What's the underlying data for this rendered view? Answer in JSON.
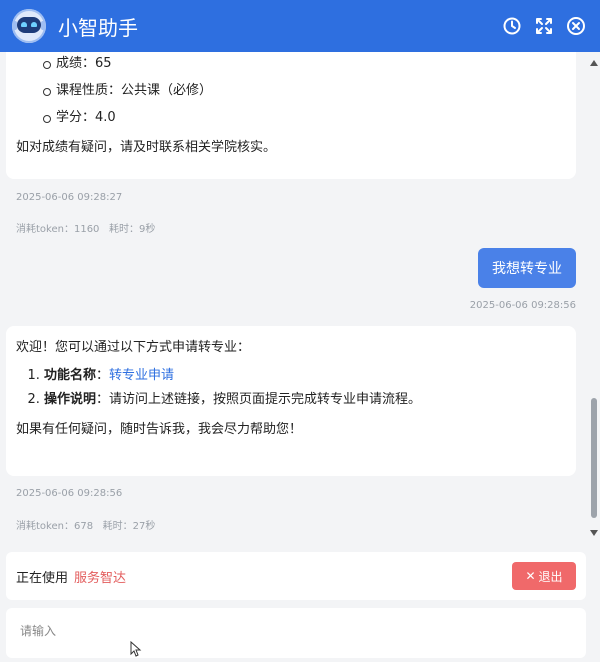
{
  "header": {
    "title": "小智助手"
  },
  "messages": {
    "m1": {
      "items": [
        "成绩：65",
        "课程性质：公共课（必修）",
        "学分：4.0"
      ],
      "note": "如对成绩有疑问，请及时联系相关学院核实。",
      "time": "2025-06-06 09:28:27",
      "tokens": "消耗token：1160",
      "elapsed": "耗时：9秒"
    },
    "m2": {
      "text": "我想转专业",
      "time": "2025-06-06 09:28:56"
    },
    "m3": {
      "intro": "欢迎！您可以通过以下方式申请转专业：",
      "item1_label": "功能名称",
      "item1_link": "转专业申请",
      "item2_label": "操作说明",
      "item2_text": "请访问上述链接，按照页面提示完成转专业申请流程。",
      "outro": "如果有任何疑问，随时告诉我，我会尽力帮助您！",
      "time": "2025-06-06 09:28:56",
      "tokens": "消耗token：678",
      "elapsed": "耗时：27秒"
    }
  },
  "status": {
    "label": "正在使用",
    "service": "服务智达",
    "exit_label": "退出"
  },
  "input": {
    "placeholder": "请输入"
  },
  "colors": {
    "header": "#2e6fe0",
    "user_bubble": "#4a81e8",
    "exit": "#f0696a",
    "service": "#e35d5d"
  }
}
